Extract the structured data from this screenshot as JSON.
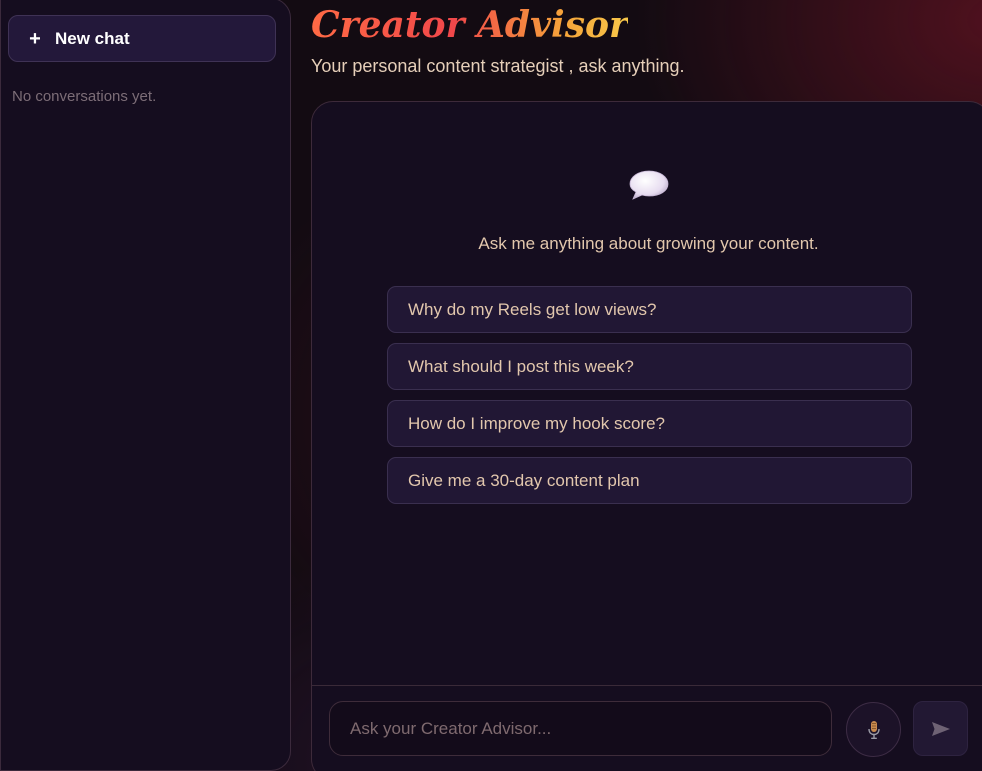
{
  "sidebar": {
    "new_chat_icon": "plus-icon",
    "new_chat_label": "New chat",
    "empty_text": "No conversations yet."
  },
  "header": {
    "title": "Creator Advisor",
    "subtitle": "Your personal content strategist , ask anything."
  },
  "chat": {
    "intro_icon": "speech-bubble-icon",
    "intro_text": "Ask me anything about growing your content.",
    "suggestions": [
      "Why do my Reels get low views?",
      "What should I post this week?",
      "How do I improve my hook score?",
      "Give me a 30-day content plan"
    ]
  },
  "composer": {
    "placeholder": "Ask your Creator Advisor...",
    "mic_icon": "microphone-icon",
    "send_icon": "send-icon"
  },
  "colors": {
    "background": "#130b12",
    "panel": "#150d1f",
    "button": "#23183a",
    "text": "#e2c7ad",
    "title_gradient_start": "#ff6a45",
    "title_gradient_end": "#f7c84a"
  }
}
